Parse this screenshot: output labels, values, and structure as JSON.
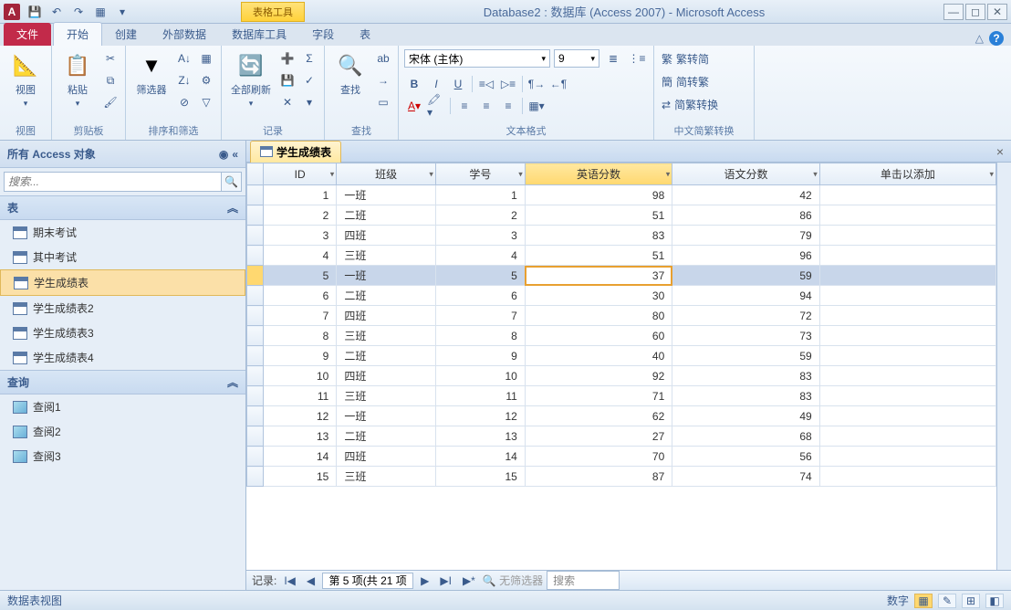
{
  "titlebar": {
    "app_letter": "A",
    "contextual_label": "表格工具",
    "title": "Database2 : 数据库 (Access 2007) - Microsoft Access"
  },
  "ribbon": {
    "tabs": [
      "文件",
      "开始",
      "创建",
      "外部数据",
      "数据库工具",
      "字段",
      "表"
    ],
    "active_tab": 1,
    "groups": {
      "view": {
        "label": "视图",
        "btn": "视图"
      },
      "clipboard": {
        "label": "剪贴板",
        "paste": "粘贴"
      },
      "sort": {
        "label": "排序和筛选",
        "filter": "筛选器"
      },
      "records": {
        "label": "记录",
        "refresh": "全部刷新"
      },
      "find": {
        "label": "查找",
        "find": "查找"
      },
      "text": {
        "label": "文本格式",
        "font": "宋体 (主体)",
        "size": "9"
      },
      "chinese": {
        "label": "中文简繁转换",
        "r1": "繁转简",
        "r2": "简转繁",
        "r3": "简繁转换"
      }
    }
  },
  "nav": {
    "header": "所有 Access 对象",
    "search_placeholder": "搜索...",
    "group_tables": "表",
    "group_queries": "查询",
    "tables": [
      "期末考试",
      "其中考试",
      "学生成绩表",
      "学生成绩表2",
      "学生成绩表3",
      "学生成绩表4"
    ],
    "selected_table": 2,
    "queries": [
      "查阅1",
      "查阅2",
      "查阅3"
    ]
  },
  "datasheet": {
    "tab_title": "学生成绩表",
    "columns": [
      "ID",
      "班级",
      "学号",
      "英语分数",
      "语文分数",
      "单击以添加"
    ],
    "highlight_col": 3,
    "selected_row": 4,
    "rows": [
      {
        "id": 1,
        "cls": "一班",
        "no": 1,
        "eng": 98,
        "chn": 42
      },
      {
        "id": 2,
        "cls": "二班",
        "no": 2,
        "eng": 51,
        "chn": 86
      },
      {
        "id": 3,
        "cls": "四班",
        "no": 3,
        "eng": 83,
        "chn": 79
      },
      {
        "id": 4,
        "cls": "三班",
        "no": 4,
        "eng": 51,
        "chn": 96
      },
      {
        "id": 5,
        "cls": "一班",
        "no": 5,
        "eng": 37,
        "chn": 59
      },
      {
        "id": 6,
        "cls": "二班",
        "no": 6,
        "eng": 30,
        "chn": 94
      },
      {
        "id": 7,
        "cls": "四班",
        "no": 7,
        "eng": 80,
        "chn": 72
      },
      {
        "id": 8,
        "cls": "三班",
        "no": 8,
        "eng": 60,
        "chn": 73
      },
      {
        "id": 9,
        "cls": "二班",
        "no": 9,
        "eng": 40,
        "chn": 59
      },
      {
        "id": 10,
        "cls": "四班",
        "no": 10,
        "eng": 92,
        "chn": 83
      },
      {
        "id": 11,
        "cls": "三班",
        "no": 11,
        "eng": 71,
        "chn": 83
      },
      {
        "id": 12,
        "cls": "一班",
        "no": 12,
        "eng": 62,
        "chn": 49
      },
      {
        "id": 13,
        "cls": "二班",
        "no": 13,
        "eng": 27,
        "chn": 68
      },
      {
        "id": 14,
        "cls": "四班",
        "no": 14,
        "eng": 70,
        "chn": 56
      },
      {
        "id": 15,
        "cls": "三班",
        "no": 15,
        "eng": 87,
        "chn": 74
      }
    ]
  },
  "recnav": {
    "label": "记录:",
    "position": "第 5 项(共 21 项",
    "no_filter": "无筛选器",
    "search": "搜索"
  },
  "statusbar": {
    "left": "数据表视图",
    "right": "数字"
  }
}
